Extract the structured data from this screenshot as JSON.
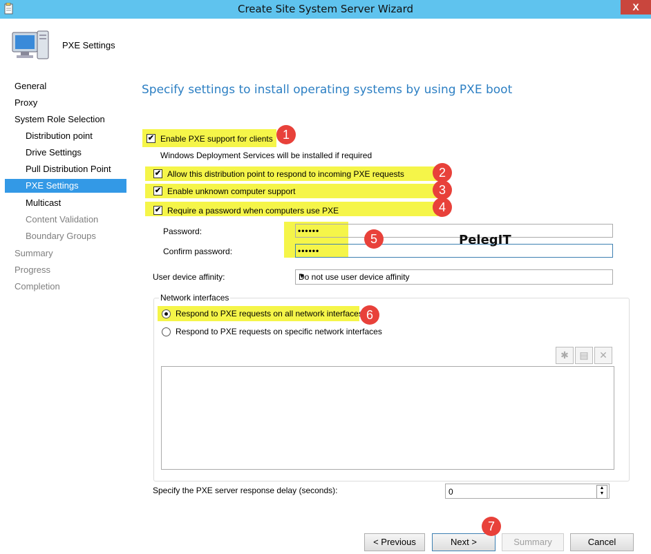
{
  "window": {
    "title": "Create Site System Server Wizard",
    "close_glyph": "X"
  },
  "header": {
    "page_title": "PXE Settings"
  },
  "nav": {
    "items": [
      {
        "label": "General"
      },
      {
        "label": "Proxy"
      },
      {
        "label": "System Role Selection"
      },
      {
        "label": "Distribution point"
      },
      {
        "label": "Drive Settings"
      },
      {
        "label": "Pull Distribution Point"
      },
      {
        "label": "PXE Settings",
        "selected": true
      },
      {
        "label": "Multicast"
      },
      {
        "label": "Content Validation"
      },
      {
        "label": "Boundary Groups"
      },
      {
        "label": "Summary"
      },
      {
        "label": "Progress"
      },
      {
        "label": "Completion"
      }
    ]
  },
  "content": {
    "heading": "Specify settings to install operating systems by using PXE boot",
    "enable_pxe": {
      "label": "Enable PXE support for clients",
      "checked": true
    },
    "wds_note": "Windows Deployment Services will be installed if required",
    "allow_respond": {
      "label": "Allow this distribution point to respond to incoming PXE requests",
      "checked": true
    },
    "unknown_support": {
      "label": "Enable unknown computer support",
      "checked": true
    },
    "require_password": {
      "label": "Require a password when computers use PXE",
      "checked": true
    },
    "password": {
      "label": "Password:",
      "value": "••••••"
    },
    "confirm_password": {
      "label": "Confirm password:",
      "value": "••••••"
    },
    "watermark": "PelegIT",
    "user_affinity": {
      "label": "User device affinity:",
      "value": "Do not use user device affinity"
    },
    "network": {
      "group_label": "Network interfaces",
      "all_interfaces": {
        "label": "Respond to PXE requests on all network interfaces",
        "selected": true
      },
      "specific_interfaces": {
        "label": "Respond to PXE requests on specific network interfaces",
        "selected": false
      }
    },
    "delay": {
      "label": "Specify the PXE server response delay (seconds):",
      "value": "0"
    }
  },
  "badges": [
    "1",
    "2",
    "3",
    "4",
    "5",
    "6",
    "7"
  ],
  "buttons": {
    "previous": "< Previous",
    "next": "Next >",
    "summary": "Summary",
    "cancel": "Cancel"
  },
  "colors": {
    "titlebar": "#5fc3ee",
    "highlight": "#f5f549",
    "badge": "#e8413a",
    "heading": "#2c7fc3",
    "nav_selected": "#3399e6",
    "close": "#c9463d"
  }
}
